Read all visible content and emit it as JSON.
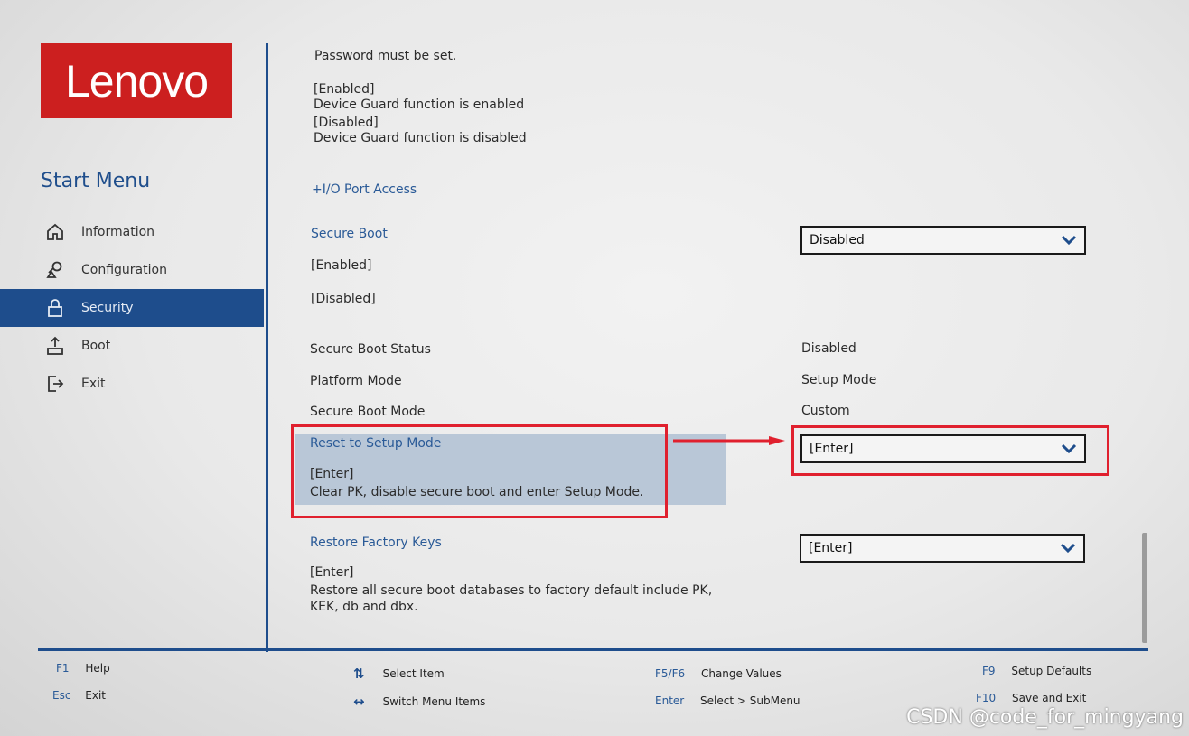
{
  "brand": {
    "logo_text": "Lenovo",
    "color": "#cc1f1f"
  },
  "sidebar": {
    "title": "Start Menu",
    "items": [
      {
        "label": "Information",
        "icon": "home-icon",
        "active": false
      },
      {
        "label": "Configuration",
        "icon": "config-icon",
        "active": false
      },
      {
        "label": "Security",
        "icon": "lock-icon",
        "active": true
      },
      {
        "label": "Boot",
        "icon": "boot-icon",
        "active": false
      },
      {
        "label": "Exit",
        "icon": "exit-icon",
        "active": false
      }
    ]
  },
  "content": {
    "top_text": [
      "Password must be set.",
      "[Enabled]",
      "Device Guard function is enabled",
      "[Disabled]",
      "Device Guard function is disabled"
    ],
    "io_port_access": "+I/O Port Access",
    "secure_boot": {
      "label": "Secure Boot",
      "value": "Disabled",
      "option_enabled": "[Enabled]",
      "option_disabled": "[Disabled]"
    },
    "status_rows": [
      {
        "label": "Secure Boot Status",
        "value": "Disabled"
      },
      {
        "label": "Platform Mode",
        "value": "Setup Mode"
      },
      {
        "label": "Secure Boot Mode",
        "value": "Custom"
      }
    ],
    "reset_setup_mode": {
      "label": "Reset to Setup Mode",
      "help_line1": "[Enter]",
      "help_line2": "Clear PK, disable secure boot and enter Setup Mode.",
      "value": "[Enter]"
    },
    "restore_factory_keys": {
      "label": "Restore Factory Keys",
      "help_line1": "[Enter]",
      "help_line2": "Restore all secure boot databases to factory default include PK,",
      "help_line3": "KEK, db and dbx.",
      "value": "[Enter]"
    }
  },
  "footer": {
    "f1_key": "F1",
    "f1_label": "Help",
    "esc_key": "Esc",
    "esc_label": "Exit",
    "select_item_icon": "up-down-arrows-icon",
    "select_item_label": "Select Item",
    "switch_menu_icon": "left-right-arrows-icon",
    "switch_menu_label": "Switch Menu Items",
    "f5f6_key": "F5/F6",
    "f5f6_label": "Change Values",
    "enter_key": "Enter",
    "enter_label": "Select > SubMenu",
    "f9_key": "F9",
    "f9_label": "Setup Defaults",
    "f10_key": "F10",
    "f10_label": "Save and Exit"
  },
  "watermark": "CSDN @code_for_mingyang",
  "colors": {
    "accent": "#1e4d8c",
    "annotation_red": "#e0202e",
    "highlight": "#b9c7d7"
  }
}
